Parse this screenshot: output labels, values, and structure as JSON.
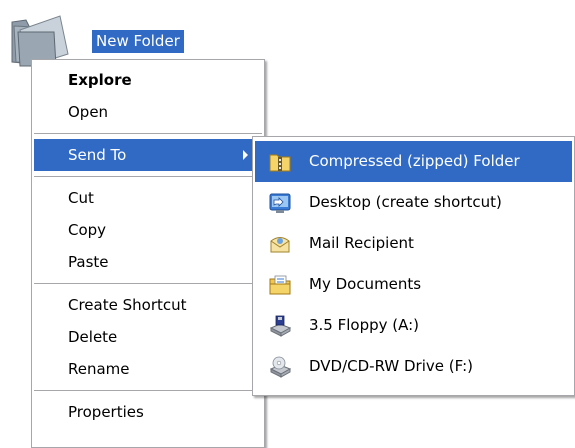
{
  "desktop": {
    "folder_label": "New Folder",
    "folder_icon": "folder-icon"
  },
  "context_menu": {
    "items": [
      {
        "label": "Explore",
        "bold": true
      },
      {
        "label": "Open"
      },
      {
        "label": "Send To",
        "selected": true,
        "has_submenu": true
      },
      {
        "label": "Cut"
      },
      {
        "label": "Copy"
      },
      {
        "label": "Paste"
      },
      {
        "label": "Create Shortcut"
      },
      {
        "label": "Delete"
      },
      {
        "label": "Rename"
      },
      {
        "label": "Properties"
      }
    ]
  },
  "send_to_menu": {
    "items": [
      {
        "label": "Compressed (zipped) Folder",
        "icon": "zip-folder-icon",
        "selected": true
      },
      {
        "label": "Desktop (create shortcut)",
        "icon": "desktop-shortcut-icon"
      },
      {
        "label": "Mail Recipient",
        "icon": "mail-icon"
      },
      {
        "label": "My Documents",
        "icon": "documents-icon"
      },
      {
        "label": "3.5 Floppy (A:)",
        "icon": "floppy-drive-icon"
      },
      {
        "label": "DVD/CD-RW Drive (F:)",
        "icon": "dvd-drive-icon"
      }
    ]
  },
  "colors": {
    "selection": "#316ac5",
    "menu_border": "#a7a6aa",
    "menu_background": "#ffffff"
  }
}
